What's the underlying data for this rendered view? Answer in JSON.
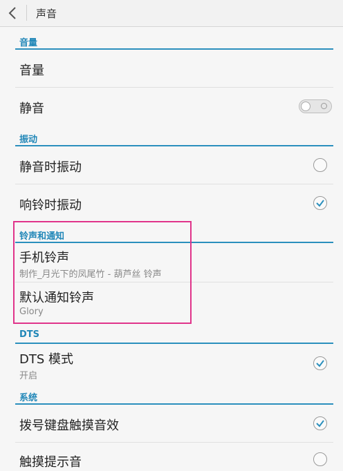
{
  "header": {
    "title": "声音"
  },
  "sections": {
    "volume": "音量",
    "vibrate": "振动",
    "ringtones": "铃声和通知",
    "dts": "DTS",
    "system": "系统"
  },
  "rows": {
    "volume": {
      "title": "音量"
    },
    "mute": {
      "title": "静音",
      "toggle_state": "off"
    },
    "vibrate_silent": {
      "title": "静音时振动",
      "checked": false
    },
    "vibrate_ring": {
      "title": "响铃时振动",
      "checked": true
    },
    "phone_ringtone": {
      "title": "手机铃声",
      "subtitle": "制作_月光下的凤尾竹 - 葫芦丝 铃声"
    },
    "notify_ringtone": {
      "title": "默认通知铃声",
      "subtitle": "Glory"
    },
    "dts_mode": {
      "title": "DTS 模式",
      "subtitle": "开启",
      "checked": true
    },
    "dial_touch": {
      "title": "拨号键盘触摸音效",
      "checked": true
    },
    "touch_sound": {
      "title": "触摸提示音",
      "checked": false
    }
  },
  "colors": {
    "accent": "#2187b8",
    "highlight": "#e0338a"
  }
}
